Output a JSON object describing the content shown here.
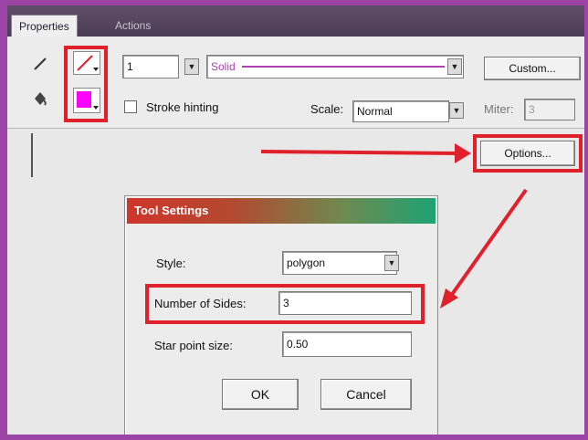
{
  "tabs": {
    "properties": "Properties",
    "actions": "Actions"
  },
  "stroke": {
    "weight": "1",
    "style": "Solid",
    "custom_button": "Custom...",
    "hinting_label": "Stroke hinting",
    "scale_label": "Scale:",
    "scale_value": "Normal",
    "miter_label": "Miter:",
    "miter_value": "3",
    "options_button": "Options..."
  },
  "colors": {
    "stroke_line": "#e0202a",
    "fill": "#ff00ff",
    "accent_red": "#e0202a",
    "frame": "#9c44a6"
  },
  "dialog": {
    "title": "Tool Settings",
    "style_label": "Style:",
    "style_value": "polygon",
    "sides_label": "Number of Sides:",
    "sides_value": "3",
    "star_label": "Star point size:",
    "star_value": "0.50",
    "ok_button": "OK",
    "cancel_button": "Cancel"
  }
}
